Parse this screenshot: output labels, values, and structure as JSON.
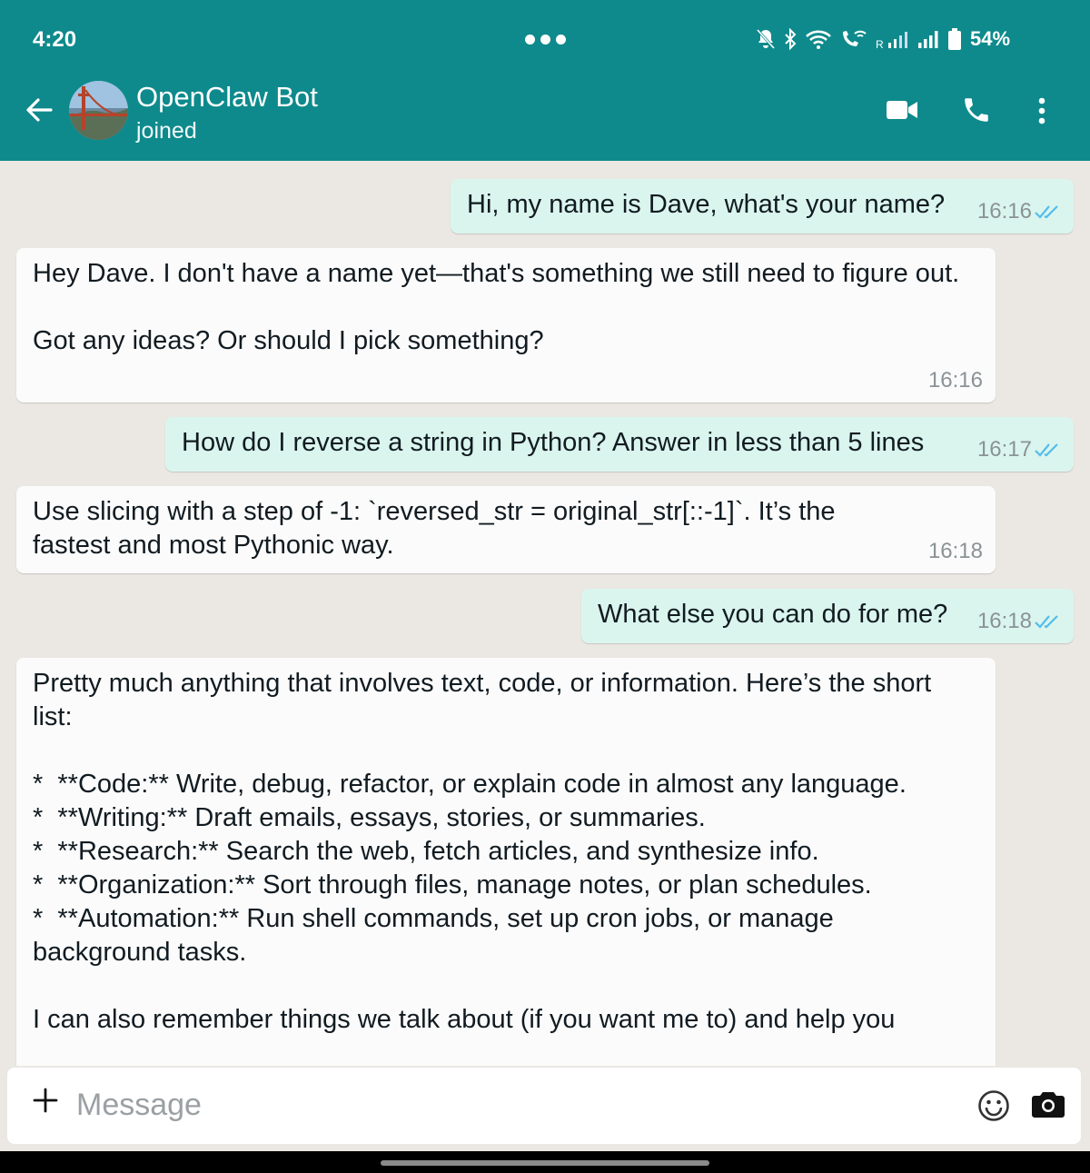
{
  "status_bar": {
    "time": "4:20",
    "battery": "54%",
    "icons": [
      "mute-icon",
      "bluetooth-icon",
      "wifi-icon",
      "wifi-calling-icon",
      "roaming-signal-icon",
      "signal-icon",
      "battery-icon"
    ]
  },
  "header": {
    "contact_name": "OpenClaw Bot",
    "contact_status": "joined",
    "icons": [
      "back-arrow-icon",
      "avatar",
      "video-call-icon",
      "voice-call-icon",
      "more-options-icon"
    ],
    "color": "#0e8a8c"
  },
  "messages": [
    {
      "direction": "out",
      "text": "Hi, my name is Dave, what's your name?",
      "time": "16:16",
      "read": true
    },
    {
      "direction": "in",
      "text": "Hey Dave. I don't have a name yet—that's something we still need to figure out.\n\nGot any ideas? Or should I pick something?",
      "time": "16:16"
    },
    {
      "direction": "out",
      "text": "How do I reverse a string in Python? Answer in less than 5 lines",
      "time": "16:17",
      "read": true
    },
    {
      "direction": "in",
      "text": "Use slicing with a step of -1: `reversed_str = original_str[::-1]`. It’s the fastest and most Pythonic way.",
      "time": "16:18"
    },
    {
      "direction": "out",
      "text": "What else you can do for me?",
      "time": "16:18",
      "read": true
    },
    {
      "direction": "in",
      "text": "Pretty much anything that involves text, code, or information. Here’s the short list:\n\n*  **Code:** Write, debug, refactor, or explain code in almost any language.\n*  **Writing:** Draft emails, essays, stories, or summaries.\n*  **Research:** Search the web, fetch articles, and synthesize info.\n*  **Organization:** Sort through files, manage notes, or plan schedules.\n*  **Automation:** Run shell commands, set up cron jobs, or manage background tasks.\n\nI can also remember things we talk about (if you want me to) and help you",
      "time": ""
    }
  ],
  "composer": {
    "placeholder": "Message",
    "icons": [
      "plus-icon",
      "emoji-icon",
      "camera-icon"
    ]
  },
  "colors": {
    "header": "#0e8a8c",
    "chat_background": "#ebe8e3",
    "outgoing_bubble": "#daf5ee",
    "incoming_bubble": "#fbfbfb",
    "read_ticks": "#53bdeb"
  }
}
